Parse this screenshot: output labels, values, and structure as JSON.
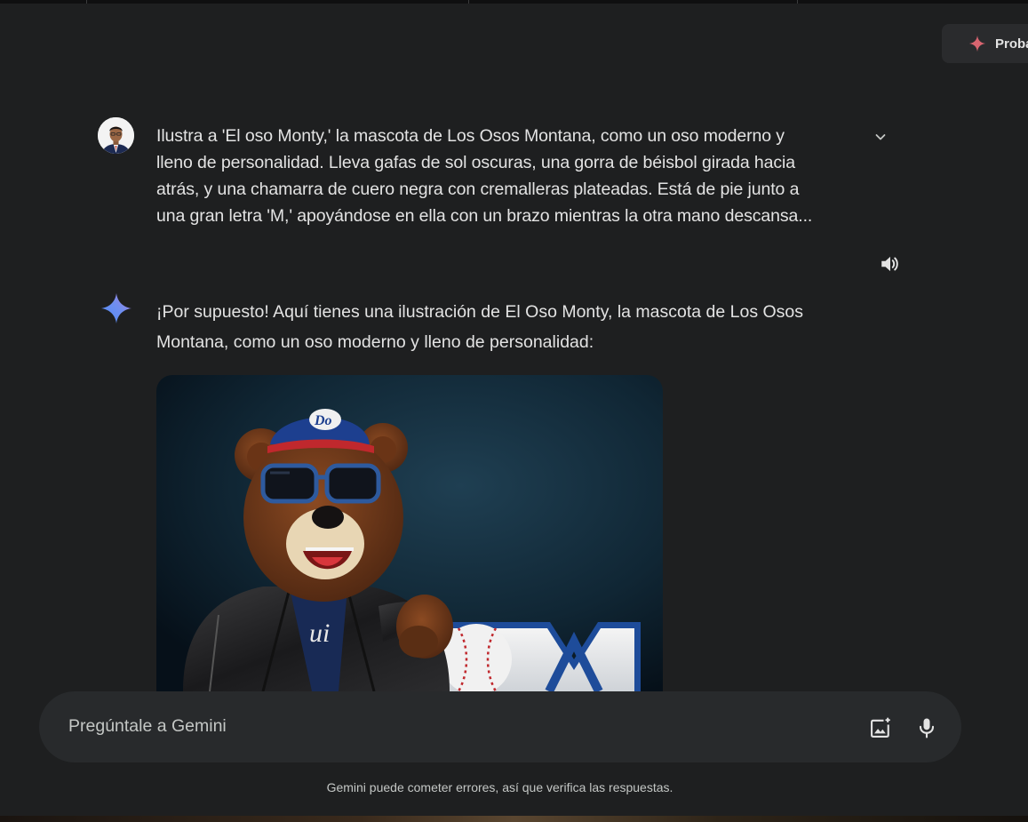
{
  "top_bar": {
    "try_button_label": "Proba"
  },
  "user_turn": {
    "avatar_icon": "user-avatar",
    "prompt_lines": [
      "Ilustra a 'El oso Monty,' la mascota de Los Osos Montana, como un oso moderno y",
      "lleno de personalidad. Lleva gafas de sol oscuras, una gorra de béisbol girada hacia",
      "atrás, y una chamarra de cuero negra con cremalleras plateadas. Está de pie junto a",
      "una gran letra 'M,' apoyándose en ella con un brazo mientras la otra mano descansa..."
    ],
    "expand_icon": "chevron-down-icon",
    "speaker_icon": "volume-icon"
  },
  "model_turn": {
    "response_lines": [
      "¡Por supuesto! Aquí tienes una ilustración de El Oso Monty, la mascota de Los Osos",
      "Montana, como un oso moderno y lleno de personalidad:"
    ],
    "image_subject": "bear mascot with cap, sunglasses and leather jacket leaning on a letter M"
  },
  "input": {
    "placeholder": "Pregúntale a Gemini",
    "value": "",
    "image_icon": "add-image-icon",
    "mic_icon": "microphone-icon"
  },
  "footer": {
    "disclaimer": "Gemini puede cometer errores, así que verifica las respuestas."
  },
  "colors": {
    "background": "#1e1f20",
    "input_bg": "#282a2c",
    "text": "#e3e3e3",
    "muted_text": "#c4c7c5",
    "spark_blue": "#4e8cf7",
    "spark_purple": "#9b72cb",
    "spark_red": "#d96570"
  }
}
